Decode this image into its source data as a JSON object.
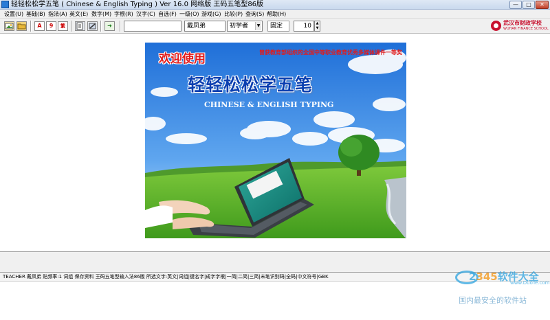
{
  "window": {
    "title": "轻轻松松学五笔 ( Chinese & English Typing ) Ver 16.0 网络版    王码五笔型86版",
    "min_label": "—",
    "max_label": "□",
    "close_label": "✕"
  },
  "menu": {
    "items": [
      {
        "label": "设置(U)"
      },
      {
        "label": "基础(B)"
      },
      {
        "label": "指法(A)"
      },
      {
        "label": "英文(E)"
      },
      {
        "label": "数字(M)"
      },
      {
        "label": "字根(R)"
      },
      {
        "label": "汉字(C)"
      },
      {
        "label": "自选(F)"
      },
      {
        "label": "一级(O)"
      },
      {
        "label": "游戏(G)"
      },
      {
        "label": "比较(P)"
      },
      {
        "label": "查询(S)"
      },
      {
        "label": "帮助(H)"
      }
    ]
  },
  "toolbar": {
    "btn_a": "A",
    "btn_9": "9",
    "btn_fz": "繁",
    "btn_exit": "➜",
    "text_field": "",
    "name_field": "戴凤弟",
    "level_select": "初学者",
    "mode_field": "固定",
    "speed_field": "10"
  },
  "school": {
    "name_cn": "武汉市财政学校",
    "name_en": "WUHAN FINANCE SCHOOL"
  },
  "banner": {
    "welcome": "欢迎使用",
    "award": "曾获教育部组织的全国中等职业教育优秀多媒体课件一等奖",
    "title": "轻轻松松学五笔",
    "subtitle": "CHINESE & ENGLISH TYPING"
  },
  "status": {
    "text": "TEACHER  戴凤弟    贴频率:1  词组  保存资料  王码五笔型输入法86版  所选文字:英文|词组|键名字|成字字根|一简|二简|三简|末笔识别码|全码|中文符号|GBK"
  },
  "watermark": {
    "logo_prefix": "2",
    "logo_mid": "345",
    "logo_suffix": "软件大全",
    "url": "www.DuoTe.com",
    "tagline": "国内最安全的软件站"
  },
  "colors": {
    "title_blue": "#0a3fb0",
    "welcome_red": "#e21b1b",
    "school_red": "#c8102e",
    "watermark_blue": "#3aa7e0"
  }
}
